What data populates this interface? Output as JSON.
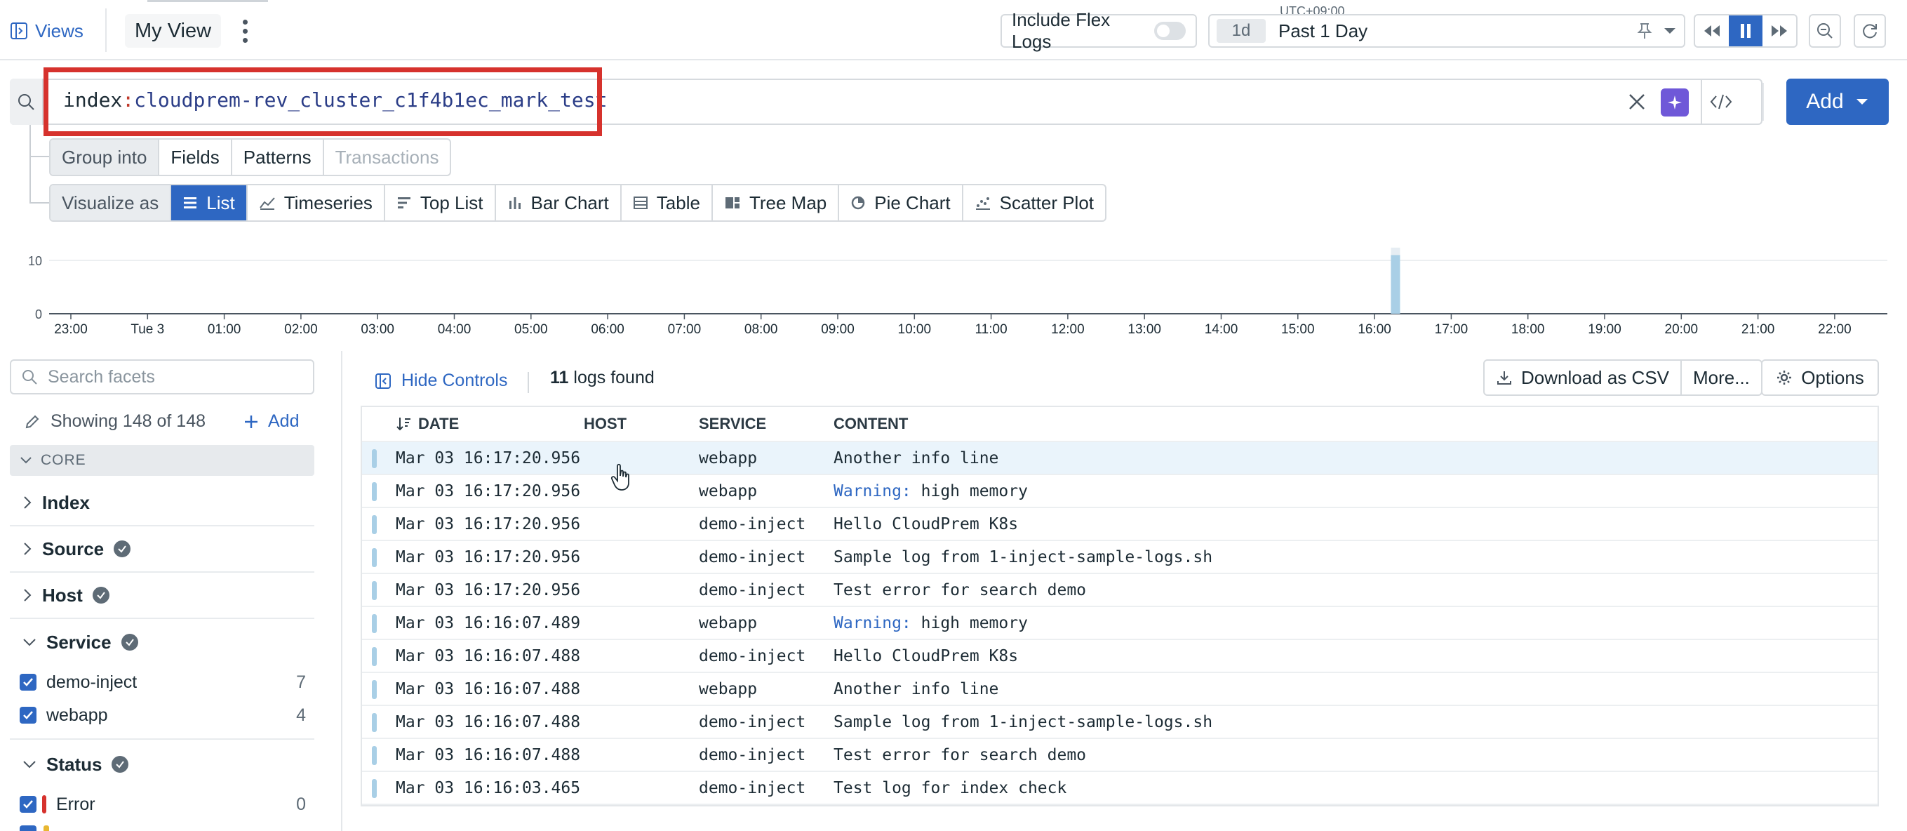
{
  "topbar": {
    "views_label": "Views",
    "view_name": "My View",
    "flex_logs_label": "Include Flex Logs",
    "timezone": "UTC+09:00",
    "range_short": "1d",
    "range_label": "Past 1 Day"
  },
  "search": {
    "query_key": "index",
    "query_colon": ":",
    "query_value": "cloudprem-rev_cluster_c1f4b1ec_mark_test",
    "add_label": "Add"
  },
  "group_into": {
    "label": "Group into",
    "options": [
      "Fields",
      "Patterns",
      "Transactions"
    ]
  },
  "visualize": {
    "label": "Visualize as",
    "options": [
      "List",
      "Timeseries",
      "Top List",
      "Bar Chart",
      "Table",
      "Tree Map",
      "Pie Chart",
      "Scatter Plot"
    ],
    "selected": "List"
  },
  "chart_data": {
    "type": "bar",
    "y_ticks": [
      "10",
      "0"
    ],
    "ylim": [
      0,
      12
    ],
    "x_ticks": [
      "23:00",
      "Tue 3",
      "01:00",
      "02:00",
      "03:00",
      "04:00",
      "05:00",
      "06:00",
      "07:00",
      "08:00",
      "09:00",
      "10:00",
      "11:00",
      "12:00",
      "13:00",
      "14:00",
      "15:00",
      "16:00",
      "17:00",
      "18:00",
      "19:00",
      "20:00",
      "21:00",
      "22:00"
    ],
    "bars": [
      {
        "time": "16:15",
        "value": 11
      }
    ],
    "bar_color": "#a9cfe6"
  },
  "facets": {
    "search_placeholder": "Search facets",
    "showing": "Showing 148 of 148",
    "add_label": "Add",
    "core_label": "CORE",
    "groups": [
      "Index",
      "Source",
      "Host",
      "Service",
      "Status"
    ],
    "service_values": [
      {
        "name": "demo-inject",
        "count": "7"
      },
      {
        "name": "webapp",
        "count": "4"
      }
    ],
    "status_values": [
      {
        "name": "Error",
        "count": "0",
        "color": "#d6322d"
      }
    ]
  },
  "results": {
    "hide_controls": "Hide Controls",
    "count": "11",
    "count_suffix": " logs found",
    "download_label": "Download as CSV",
    "more_label": "More...",
    "options_label": "Options",
    "columns": [
      "DATE",
      "HOST",
      "SERVICE",
      "CONTENT"
    ],
    "rows": [
      {
        "date": "Mar 03 16:17:20.956",
        "host": "",
        "service": "webapp",
        "content": "Another info line",
        "warn": ""
      },
      {
        "date": "Mar 03 16:17:20.956",
        "host": "",
        "service": "webapp",
        "content": " high memory",
        "warn": "Warning:"
      },
      {
        "date": "Mar 03 16:17:20.956",
        "host": "",
        "service": "demo-inject",
        "content": "Hello CloudPrem K8s",
        "warn": ""
      },
      {
        "date": "Mar 03 16:17:20.956",
        "host": "",
        "service": "demo-inject",
        "content": "Sample log from 1-inject-sample-logs.sh",
        "warn": ""
      },
      {
        "date": "Mar 03 16:17:20.956",
        "host": "",
        "service": "demo-inject",
        "content": "Test error for search demo",
        "warn": ""
      },
      {
        "date": "Mar 03 16:16:07.489",
        "host": "",
        "service": "webapp",
        "content": " high memory",
        "warn": "Warning:"
      },
      {
        "date": "Mar 03 16:16:07.488",
        "host": "",
        "service": "demo-inject",
        "content": "Hello CloudPrem K8s",
        "warn": ""
      },
      {
        "date": "Mar 03 16:16:07.488",
        "host": "",
        "service": "webapp",
        "content": "Another info line",
        "warn": ""
      },
      {
        "date": "Mar 03 16:16:07.488",
        "host": "",
        "service": "demo-inject",
        "content": "Sample log from 1-inject-sample-logs.sh",
        "warn": ""
      },
      {
        "date": "Mar 03 16:16:07.488",
        "host": "",
        "service": "demo-inject",
        "content": "Test error for search demo",
        "warn": ""
      },
      {
        "date": "Mar 03 16:16:03.465",
        "host": "",
        "service": "demo-inject",
        "content": "Test log for index check",
        "warn": ""
      }
    ]
  },
  "colors": {
    "accent": "#2e67c2",
    "highlight_box": "#d6322d",
    "ai_button": "#6f58d8"
  }
}
